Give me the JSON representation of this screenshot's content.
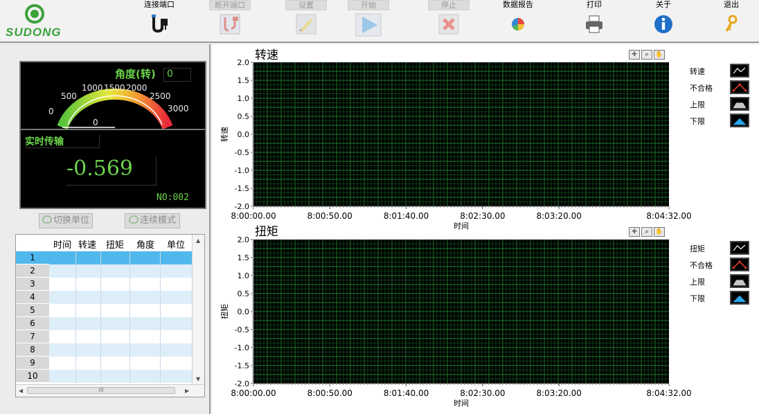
{
  "toolbar": {
    "logo_text": "SUDONG",
    "buttons": [
      {
        "label": "连接端口",
        "icon": "plug-connect-icon",
        "enabled": true
      },
      {
        "label": "断开端口",
        "icon": "plug-disconnect-icon",
        "enabled": false
      },
      {
        "label": "设置",
        "icon": "settings-pencil-icon",
        "enabled": false
      },
      {
        "label": "开始",
        "icon": "play-icon",
        "enabled": false
      },
      {
        "label": "停止",
        "icon": "stop-x-icon",
        "enabled": false
      },
      {
        "label": "数据报告",
        "icon": "pie-chart-icon",
        "enabled": true
      },
      {
        "label": "打印",
        "icon": "printer-icon",
        "enabled": true
      },
      {
        "label": "关于",
        "icon": "info-icon",
        "enabled": true
      },
      {
        "label": "退出",
        "icon": "key-exit-icon",
        "enabled": true
      }
    ]
  },
  "gauge": {
    "title": "角度(转)",
    "readout": "0",
    "needle_value": "0",
    "ticks": [
      "0",
      "500",
      "1000",
      "1500",
      "2000",
      "2500",
      "3000"
    ],
    "min": 0,
    "max": 3000,
    "value": 0
  },
  "realtime": {
    "label": "实时传输",
    "value": "-0.569",
    "number": "NO:002"
  },
  "buttons": {
    "switch_unit": "切换单位",
    "continuous_mode": "连续模式"
  },
  "table": {
    "columns": [
      "时间",
      "转速",
      "扭矩",
      "角度",
      "单位"
    ],
    "rows": [
      "1",
      "2",
      "3",
      "4",
      "5",
      "6",
      "7",
      "8",
      "9",
      "10"
    ],
    "selected_row": "1",
    "hscroll_grip": "III"
  },
  "chart_data": [
    {
      "type": "line",
      "title": "转速",
      "xlabel": "时间",
      "ylabel": "转速",
      "x_ticks": [
        "8:00:00.00",
        "8:00:50.00",
        "8:01:40.00",
        "8:02:30.00",
        "8:03:20.00",
        "8:04:32.00"
      ],
      "y_ticks": [
        "2.0",
        "1.5",
        "1.0",
        "0.5",
        "0.0",
        "-0.5",
        "-1.0",
        "-1.5",
        "-2.0"
      ],
      "ylim": [
        -2.0,
        2.0
      ],
      "grid": true,
      "legend_position": "right",
      "series": [
        {
          "name": "转速",
          "values": [],
          "color": "#ffffff"
        },
        {
          "name": "不合格",
          "values": [],
          "color": "#e23c2c"
        },
        {
          "name": "上限",
          "values": [],
          "color": "#c8c8c8"
        },
        {
          "name": "下限",
          "values": [],
          "color": "#2aa4e8"
        }
      ]
    },
    {
      "type": "line",
      "title": "扭矩",
      "xlabel": "时间",
      "ylabel": "扭矩",
      "x_ticks": [
        "8:00:00.00",
        "8:00:50.00",
        "8:01:40.00",
        "8:02:30.00",
        "8:03:20.00",
        "8:04:32.00"
      ],
      "y_ticks": [
        "2.0",
        "1.5",
        "1.0",
        "0.5",
        "0.0",
        "-0.5",
        "-1.0",
        "-1.5",
        "-2.0"
      ],
      "ylim": [
        -2.0,
        2.0
      ],
      "grid": true,
      "legend_position": "right",
      "series": [
        {
          "name": "扭矩",
          "values": [],
          "color": "#ffffff"
        },
        {
          "name": "不合格",
          "values": [],
          "color": "#e23c2c"
        },
        {
          "name": "上限",
          "values": [],
          "color": "#c8c8c8"
        },
        {
          "name": "下限",
          "values": [],
          "color": "#2aa4e8"
        }
      ]
    }
  ],
  "colors": {
    "plot_bg": "#000000",
    "grid_major": "#1f7a2e",
    "grid_minor": "#0d3d16",
    "lcd_green": "#6cd44c",
    "selected_row": "#50b8ec",
    "alt_row": "#deeef9"
  }
}
